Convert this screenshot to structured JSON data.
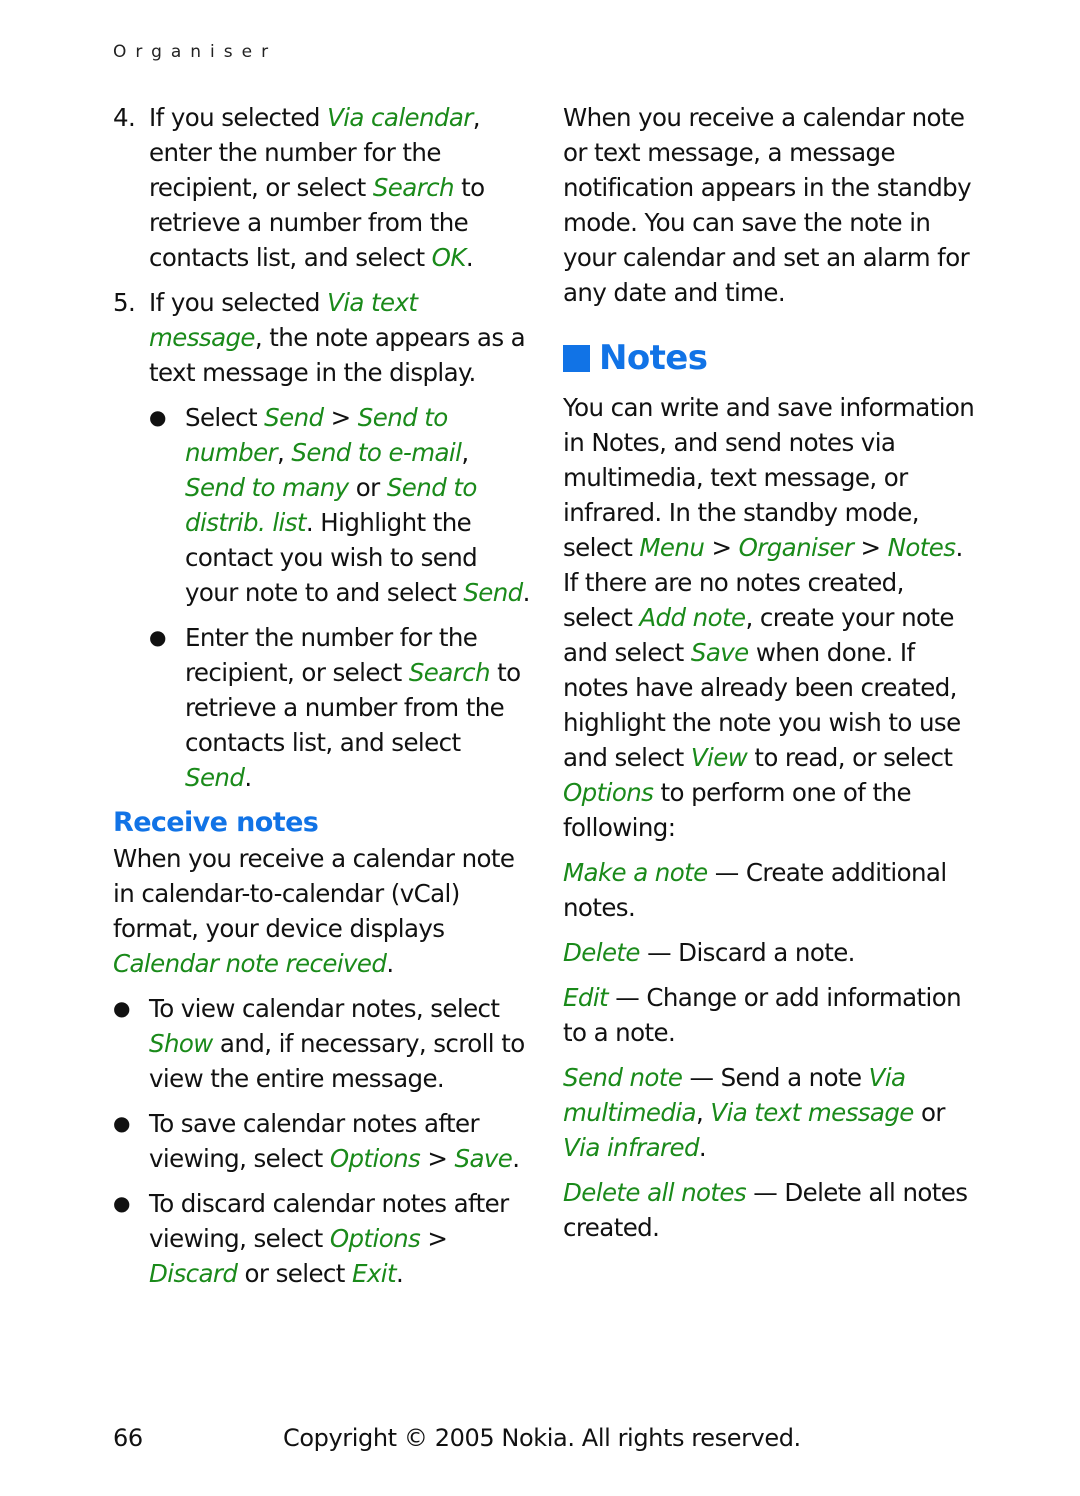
{
  "colors": {
    "link": "#1a8a1a",
    "heading": "#1173e6",
    "text": "#111111"
  },
  "running_head": "Organiser",
  "left_column": {
    "step4": {
      "number": "4.",
      "runs": [
        {
          "t": "If you selected "
        },
        {
          "t": "Via calendar",
          "em": true
        },
        {
          "t": ", enter the number for the recipient, or select "
        },
        {
          "t": "Search",
          "em": true
        },
        {
          "t": " to retrieve a number from the contacts list, and select "
        },
        {
          "t": "OK",
          "em": true
        },
        {
          "t": "."
        }
      ]
    },
    "step5": {
      "number": "5.",
      "runs": [
        {
          "t": "If you selected "
        },
        {
          "t": "Via text message",
          "em": true
        },
        {
          "t": ", the note appears as a text message in the display."
        }
      ]
    },
    "step5_bullets": [
      {
        "runs": [
          {
            "t": "Select "
          },
          {
            "t": "Send",
            "em": true
          },
          {
            "t": " > "
          },
          {
            "t": "Send to number",
            "em": true
          },
          {
            "t": ", "
          },
          {
            "t": "Send to e-mail",
            "em": true
          },
          {
            "t": ", "
          },
          {
            "t": "Send to many",
            "em": true
          },
          {
            "t": " or "
          },
          {
            "t": "Send to distrib. list",
            "em": true
          },
          {
            "t": ". Highlight the contact you wish to send your note to and select "
          },
          {
            "t": "Send",
            "em": true
          },
          {
            "t": "."
          }
        ]
      },
      {
        "runs": [
          {
            "t": "Enter the number for the recipient, or select "
          },
          {
            "t": "Search",
            "em": true
          },
          {
            "t": " to retrieve a number from the contacts list, and select "
          },
          {
            "t": "Send",
            "em": true
          },
          {
            "t": "."
          }
        ]
      }
    ],
    "receive_heading": "Receive notes",
    "receive_intro": {
      "runs": [
        {
          "t": "When you receive a calendar note in calendar-to-calendar (vCal) format, your device displays "
        },
        {
          "t": "Calendar note received",
          "em": true
        },
        {
          "t": "."
        }
      ]
    },
    "receive_bullets": [
      {
        "runs": [
          {
            "t": "To view calendar notes, select "
          },
          {
            "t": "Show",
            "em": true
          },
          {
            "t": " and, if necessary, scroll to view the entire message."
          }
        ]
      },
      {
        "runs": [
          {
            "t": "To save calendar notes after viewing, select "
          },
          {
            "t": "Options",
            "em": true
          },
          {
            "t": " > "
          },
          {
            "t": "Save",
            "em": true
          },
          {
            "t": "."
          }
        ]
      },
      {
        "runs": [
          {
            "t": "To discard calendar notes after viewing, select "
          },
          {
            "t": "Options",
            "em": true
          },
          {
            "t": " > "
          },
          {
            "t": "Discard",
            "em": true
          },
          {
            "t": " or select "
          },
          {
            "t": "Exit",
            "em": true
          },
          {
            "t": "."
          }
        ]
      }
    ]
  },
  "right_column": {
    "continuation": {
      "runs": [
        {
          "t": "When you receive a calendar note or text message, a message notification appears in the standby mode. You can save the note in your calendar and set an alarm for any date and time."
        }
      ]
    },
    "notes_heading": "Notes",
    "notes_intro": {
      "runs": [
        {
          "t": "You can write and save information in Notes, and send notes via multimedia, text message, or infrared. In the standby mode, select "
        },
        {
          "t": "Menu",
          "em": true
        },
        {
          "t": " > "
        },
        {
          "t": "Organiser",
          "em": true
        },
        {
          "t": " > "
        },
        {
          "t": "Notes",
          "em": true
        },
        {
          "t": ". If there are no notes created, select "
        },
        {
          "t": "Add note",
          "em": true
        },
        {
          "t": ", create your note and select "
        },
        {
          "t": "Save",
          "em": true
        },
        {
          "t": " when done. If notes have already been created, highlight the note you wish to use and select "
        },
        {
          "t": "View",
          "em": true
        },
        {
          "t": " to read, or select "
        },
        {
          "t": "Options",
          "em": true
        },
        {
          "t": " to perform one of the following:"
        }
      ]
    },
    "options": [
      {
        "runs": [
          {
            "t": "Make a note",
            "em": true
          },
          {
            "t": " — Create additional notes."
          }
        ]
      },
      {
        "runs": [
          {
            "t": "Delete",
            "em": true
          },
          {
            "t": " — Discard a note."
          }
        ]
      },
      {
        "runs": [
          {
            "t": "Edit",
            "em": true
          },
          {
            "t": " — Change or add information to a note."
          }
        ]
      },
      {
        "runs": [
          {
            "t": "Send note",
            "em": true
          },
          {
            "t": " — Send a note "
          },
          {
            "t": "Via multimedia",
            "em": true
          },
          {
            "t": ", "
          },
          {
            "t": "Via text message",
            "em": true
          },
          {
            "t": " or "
          },
          {
            "t": "Via infrared",
            "em": true
          },
          {
            "t": "."
          }
        ]
      },
      {
        "runs": [
          {
            "t": "Delete all notes",
            "em": true
          },
          {
            "t": " — Delete all notes created."
          }
        ]
      }
    ]
  },
  "footer": {
    "page_number": "66",
    "copyright": "Copyright © 2005 Nokia. All rights reserved."
  }
}
